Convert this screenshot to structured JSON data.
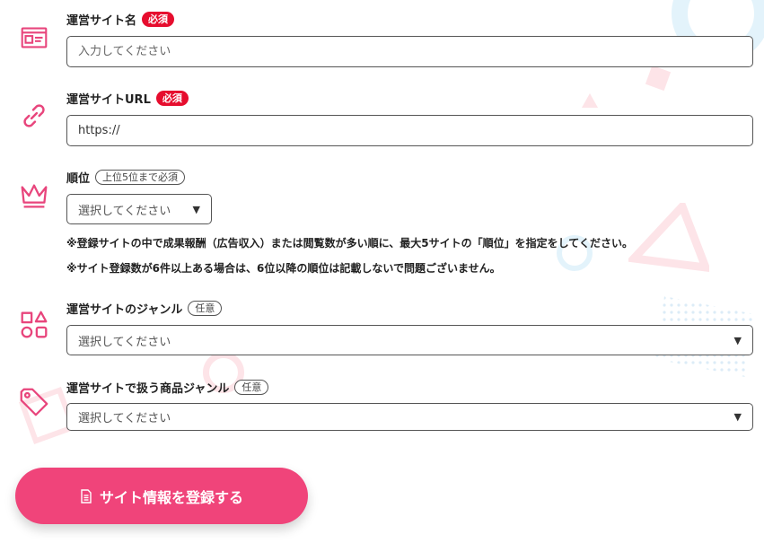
{
  "colors": {
    "accent": "#f0447a",
    "required_badge": "#e60d2e",
    "icon": "#e8457c"
  },
  "fields": {
    "site_name": {
      "label": "運営サイト名",
      "badge": "必須",
      "placeholder": "入力してください",
      "icon": "id-card-icon"
    },
    "site_url": {
      "label": "運営サイトURL",
      "badge": "必須",
      "value": "https://",
      "icon": "link-icon"
    },
    "rank": {
      "label": "順位",
      "badge": "上位5位まで必須",
      "selected": "選択してください",
      "icon": "crown-icon"
    },
    "genre": {
      "label": "運営サイトのジャンル",
      "badge": "任意",
      "selected": "選択してください",
      "icon": "shapes-icon"
    },
    "product_genre": {
      "label": "運営サイトで扱う商品ジャンル",
      "badge": "任意",
      "selected": "選択してください",
      "icon": "tag-icon"
    }
  },
  "notes": [
    "※登録サイトの中で成果報酬（広告収入）または閲覧数が多い順に、最大5サイトの「順位」を指定をしてください。",
    "※サイト登録数が6件以上ある場合は、6位以降の順位は記載しないで問題ございません。"
  ],
  "select_arrow": "▼",
  "submit": {
    "label": "サイト情報を登録する",
    "icon": "document-icon"
  }
}
